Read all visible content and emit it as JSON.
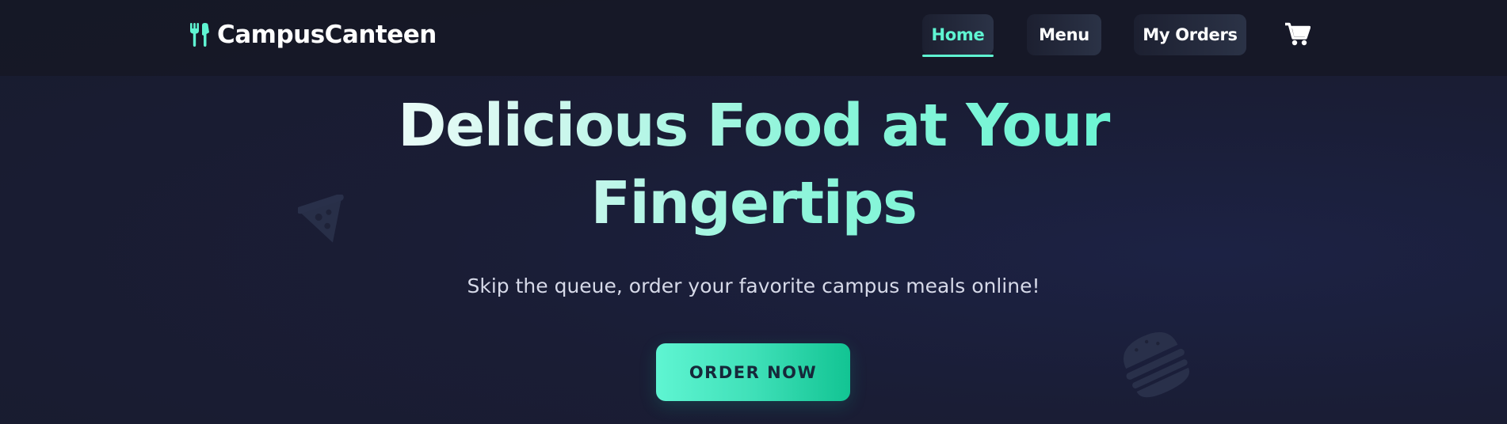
{
  "brand": {
    "name": "CampusCanteen",
    "icon": "utensils-icon",
    "accent_color": "#5ff5d2"
  },
  "nav": {
    "items": [
      {
        "label": "Home",
        "active": true
      },
      {
        "label": "Menu",
        "active": false
      },
      {
        "label": "My Orders",
        "active": false
      }
    ],
    "cart_icon": "cart-icon"
  },
  "hero": {
    "title": "Delicious Food at Your Fingertips",
    "subtitle": "Skip the queue, order your favorite campus meals online!",
    "cta_label": "ORDER NOW",
    "decorative_icons": [
      "pizza-icon",
      "burger-icon"
    ]
  },
  "colors": {
    "background": "#1a1d35",
    "accent": "#5ff5d2",
    "accent_dark": "#12c493",
    "button_text": "#16283a"
  }
}
